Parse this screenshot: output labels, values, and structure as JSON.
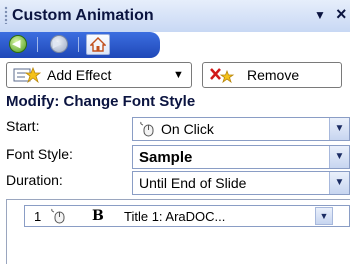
{
  "pane": {
    "title": "Custom Animation",
    "menu_arrow": "▼",
    "close": "×"
  },
  "nav": {
    "back_icon": "arrow-left-circle",
    "forward_icon": "arrow-right-circle",
    "home_icon": "home"
  },
  "buttons": {
    "add_effect": "Add Effect",
    "add_effect_arrow": "▼",
    "remove": "Remove"
  },
  "modify": {
    "heading": "Modify: Change Font Style",
    "start_label": "Start:",
    "start_value": "On Click",
    "font_style_label": "Font Style:",
    "font_style_value": "Sample",
    "duration_label": "Duration:",
    "duration_value": "Until End of Slide"
  },
  "animation_list": {
    "items": [
      {
        "number": "1",
        "trigger": "mouse-click-icon",
        "effect_glyph": "B",
        "text": "Title 1: AraDOC..."
      }
    ]
  },
  "colors": {
    "titlebar": "#c8d8f4",
    "navbar": "#1f48b8",
    "heading_text": "#0b1440"
  }
}
